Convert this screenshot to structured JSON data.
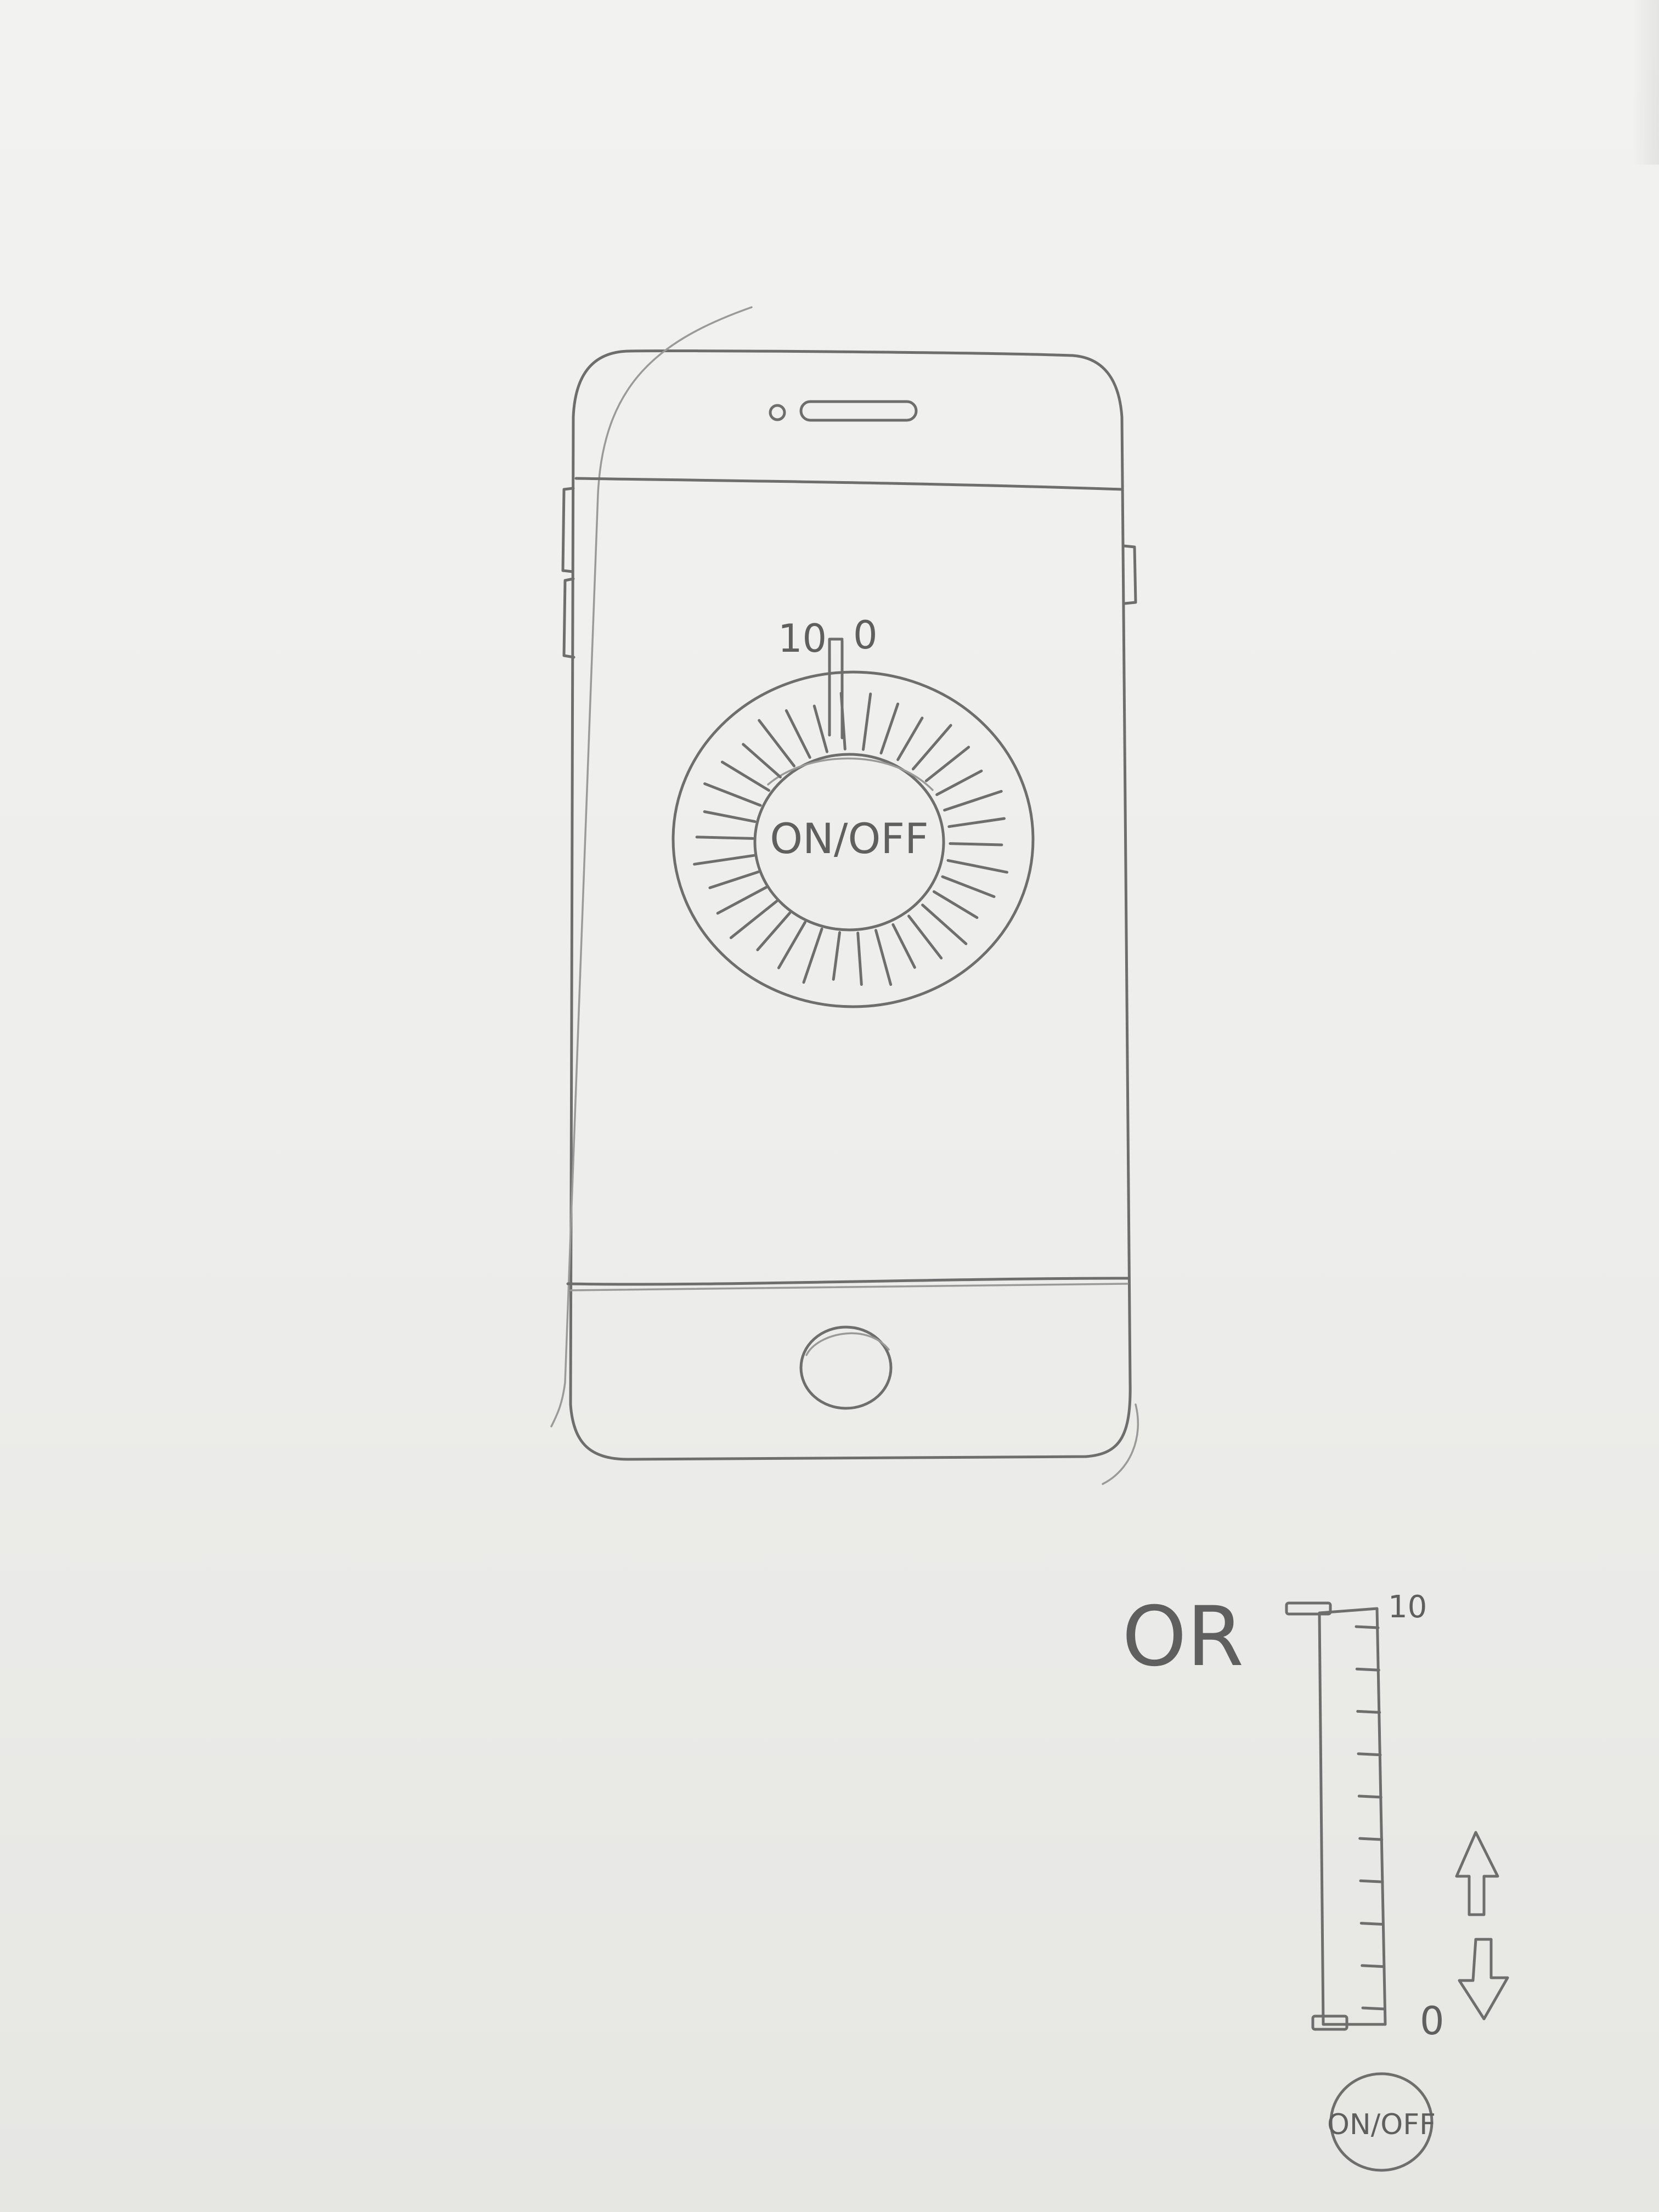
{
  "dial": {
    "max_label": "10",
    "min_label": "0",
    "center_label": "ON/OFF"
  },
  "alternative": {
    "or_label": "OR",
    "slider_max_label": "10",
    "slider_min_label": "0",
    "button_label": "ON/OFF",
    "tick_count": 10
  },
  "icons": {
    "speaker": "earpiece-speaker-icon",
    "camera": "front-camera-icon",
    "home": "home-button-icon",
    "up": "arrow-up-icon",
    "down": "arrow-down-icon"
  },
  "colors": {
    "paper": "#efefed",
    "pencil": "#6e6e6e"
  }
}
